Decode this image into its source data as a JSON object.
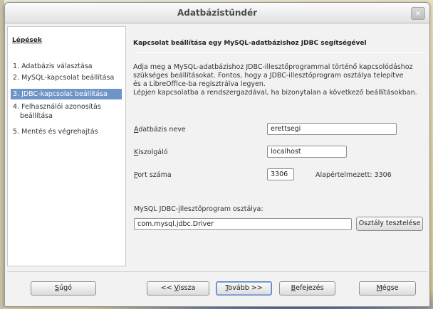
{
  "window": {
    "title": "Adatbázistündér",
    "close_icon": "×"
  },
  "steps": {
    "heading": "Lépések",
    "items": [
      {
        "label": "1. Adatbázis választása"
      },
      {
        "label": "2. MySQL-kapcsolat beállítása"
      },
      {
        "label": "3. JDBC-kapcsolat beállítása",
        "active": true
      },
      {
        "label_line1": "4. Felhasználói azonosítás",
        "label_line2": "beállítása"
      },
      {
        "label": "5. Mentés és végrehajtás"
      }
    ]
  },
  "main": {
    "heading": "Kapcsolat beállítása egy MySQL-adatbázishoz JDBC segítségével",
    "description": [
      "Adja meg a MySQL-adatbázishoz JDBC-illesztőprogrammal történő kapcsolódáshoz",
      "szükséges beállításokat. Fontos, hogy a JDBC-illesztőprogram osztálya telepítve",
      "és a LibreOffice-ba regisztrálva legyen.",
      "Lépjen kapcsolatba a rendszergazdával, ha bizonytalan a következő beállításokban."
    ],
    "database_name": {
      "label_u": "A",
      "label_rest": "datbázis neve",
      "value": "erettsegi"
    },
    "server": {
      "label_u": "K",
      "label_rest": "iszolgáló",
      "value": "localhost"
    },
    "port": {
      "label_u": "P",
      "label_rest": "ort száma",
      "value": "3306",
      "default_text": "Alapértelmezett: 3306"
    },
    "driver": {
      "label_pre": "MySQL JDBC-",
      "label_u": "i",
      "label_rest": "llesztőprogram osztálya:",
      "value": "com.mysql.jdbc.Driver",
      "test_button": "Osztály tesztelése"
    }
  },
  "footer": {
    "help": {
      "u": "S",
      "rest": "úgó"
    },
    "back": {
      "pre": "<< ",
      "u": "V",
      "rest": "issza"
    },
    "next": {
      "u": "T",
      "rest": "ovább >>"
    },
    "finish": {
      "u": "B",
      "rest": "efejezés"
    },
    "cancel": {
      "u": "M",
      "rest": "égse"
    }
  }
}
